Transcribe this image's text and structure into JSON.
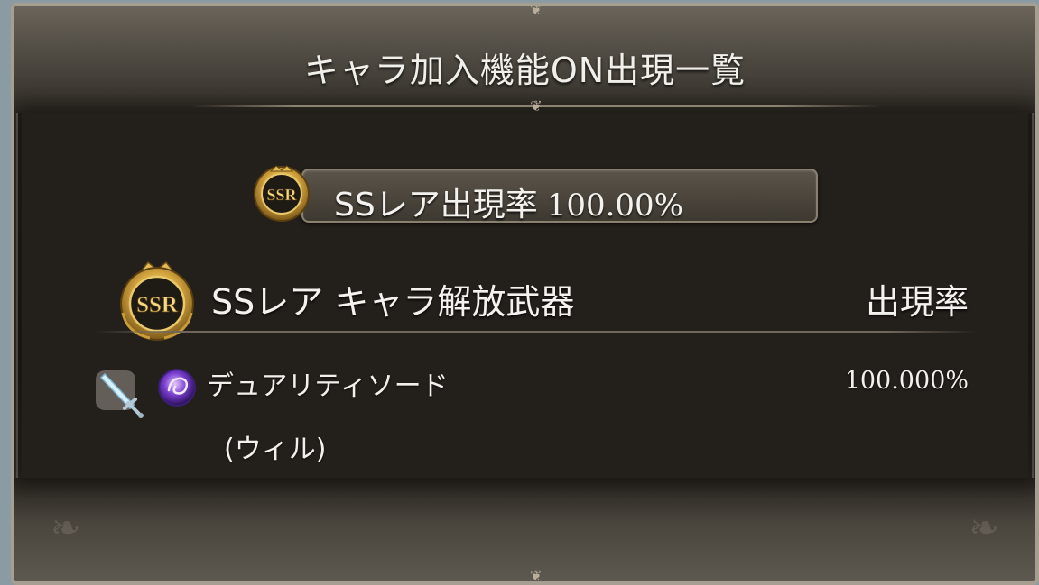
{
  "dialog": {
    "title": "キャラ加入機能ON出現一覧"
  },
  "rate_bar": {
    "label": "SSレア出現率",
    "value": "100.00%",
    "badge_text": "SSR"
  },
  "section": {
    "badge_text": "SSR",
    "title": "SSレア キャラ解放武器",
    "rate_header": "出現率"
  },
  "items": [
    {
      "name": "デュアリティソード",
      "character": "(ウィル)",
      "rate": "100.000%",
      "weapon_icon": "sword-icon",
      "element_icon": "dark-element-icon"
    }
  ],
  "colors": {
    "text": "#f2f0ec",
    "frame_border": "#a59e91",
    "panel_bg": "#231f1b",
    "badge_gold": "#c9a24a",
    "element_purple": "#7a3fd0"
  }
}
